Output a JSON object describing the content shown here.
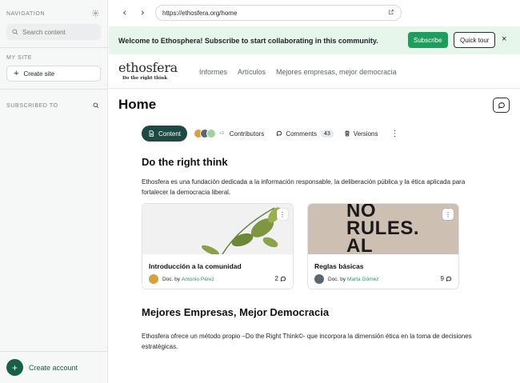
{
  "sidebar": {
    "navigation_label": "NAVIGATION",
    "search_placeholder": "Search content",
    "my_site_label": "MY SITE",
    "create_site_label": "Create site",
    "subscribed_label": "SUBSCRIBED TO",
    "create_account_label": "Create account"
  },
  "browser": {
    "url": "https://ethosfera.org/home"
  },
  "banner": {
    "text": "Welcome to Ethosphera! Subscribe to start collaborating in this community.",
    "subscribe_label": "Subscribe",
    "tour_label": "Quick tour",
    "close_icon": "×"
  },
  "site": {
    "logo_text": "ethosfera",
    "logo_tagline": "Do the right think",
    "nav": [
      "Informes",
      "Artículos",
      "Mejores empresas, mejor democracia"
    ]
  },
  "page": {
    "title": "Home",
    "tabs": {
      "content_label": "Content",
      "contributors_more": "+3",
      "contributors_label": "Contributors",
      "comments_label": "Comments",
      "comments_count": "43",
      "versions_label": "Versions"
    },
    "section1_title": "Do the right think",
    "section1_text": "Ethosfera es una fundación dedicada a la información responsable, la deliberación pública y la ética aplicada para fortalecer la democracia liberal.",
    "cards": [
      {
        "title": "Introducción a la comunidad",
        "doc_by": "Doc. by",
        "author": "Antonio Pérez",
        "comments": "2"
      },
      {
        "title": "Reglas básicas",
        "doc_by": "Doc. by",
        "author": "Marta Gómez",
        "comments": "9"
      }
    ],
    "card2_image_text": [
      "NO",
      "RULES.",
      "AL"
    ],
    "section2_title": "Mejores Empresas, Mejor Democracia",
    "section2_text": "Ethosfera ofrece un método propio –Do the Right Think©- que incorpora la dimensión ética en la toma de decisiones estratégicas."
  },
  "colors": {
    "accent_green": "#1f9d5c",
    "dark_green": "#17604a",
    "banner_bg": "#e6f6eb",
    "tab_active": "#1e4a43"
  }
}
